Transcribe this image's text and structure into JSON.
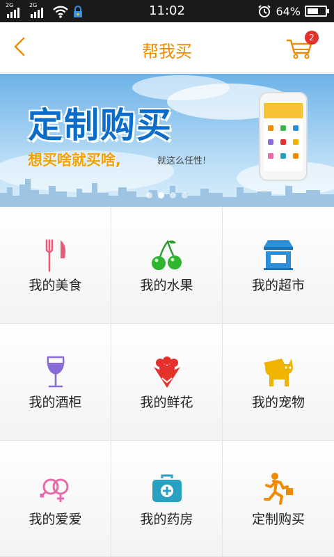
{
  "status_bar": {
    "sim1_type": "2G",
    "sim2_type": "2G",
    "time": "11:02",
    "battery_percent": "64%",
    "battery_level": 0.64,
    "icons": [
      "signal-icon",
      "signal-icon",
      "wifi-icon",
      "vpn-lock-icon",
      "alarm-icon",
      "battery-icon"
    ]
  },
  "header": {
    "title": "帮我买",
    "cart_badge": "2",
    "accent_color": "#f08a00",
    "badge_color": "#e5312c"
  },
  "banner": {
    "title": "定制购买",
    "subtitle": "想买啥就买啥,",
    "tagline": "就这么任性!",
    "slide_count": 4,
    "active_slide": 1
  },
  "categories": [
    {
      "label": "我的美食",
      "icon": "fork-knife-icon"
    },
    {
      "label": "我的水果",
      "icon": "cherry-icon"
    },
    {
      "label": "我的超市",
      "icon": "store-icon"
    },
    {
      "label": "我的酒柜",
      "icon": "wine-glass-icon"
    },
    {
      "label": "我的鲜花",
      "icon": "flower-bouquet-icon"
    },
    {
      "label": "我的宠物",
      "icon": "cat-icon"
    },
    {
      "label": "我的爱爱",
      "icon": "gender-symbols-icon"
    },
    {
      "label": "我的药房",
      "icon": "medical-kit-icon"
    },
    {
      "label": "定制购买",
      "icon": "courier-running-icon"
    }
  ]
}
